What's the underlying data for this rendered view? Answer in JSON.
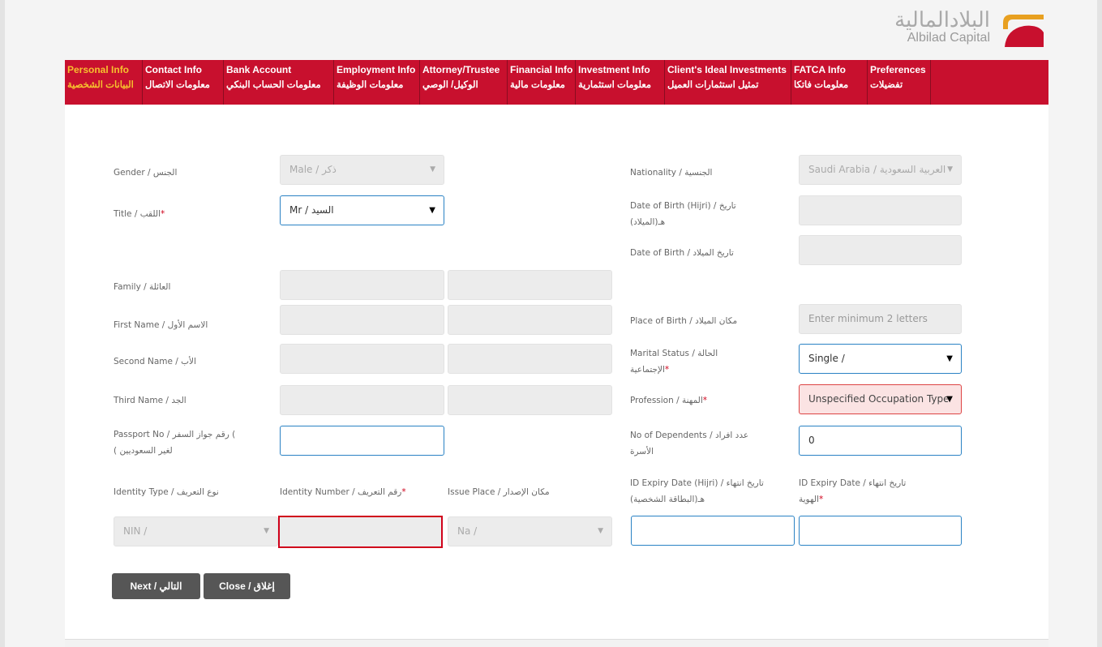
{
  "brand": {
    "name_ar": "البلادالمالية",
    "name_en": "Albilad Capital",
    "colors": {
      "primary": "#c8102e",
      "accent": "#e8a020",
      "active_tab": "#f6c02e"
    }
  },
  "nav": [
    {
      "en": "Personal Info",
      "ar": "البيانات الشخصية"
    },
    {
      "en": "Contact Info",
      "ar": "معلومات الاتصال"
    },
    {
      "en": "Bank Account",
      "ar": "معلومات الحساب البنكي"
    },
    {
      "en": "Employment Info",
      "ar": "معلومات الوظيفة"
    },
    {
      "en": "Attorney/Trustee",
      "ar": "الوكيل/ الوصي"
    },
    {
      "en": "Financial Info",
      "ar": "معلومات مالية"
    },
    {
      "en": "Investment Info",
      "ar": "معلومات استثمارية"
    },
    {
      "en": "Client's Ideal Investments",
      "ar": "تمثيل استثمارات العميل"
    },
    {
      "en": "FATCA Info",
      "ar": "معلومات فاتكا"
    },
    {
      "en": "Preferences",
      "ar": "تفضيلات"
    }
  ],
  "form": {
    "gender_label": "Gender / الجنس",
    "gender_value": "Male / ذكر",
    "title_label": "Title / اللقب",
    "title_value": "Mr / السيد",
    "family_label": "Family / العائلة",
    "first_name_label": "First Name / الاسم الأول",
    "second_name_label": "Second Name / الأب",
    "third_name_label": "Third Name / الجد",
    "passport_label_1": "Passport No / رقم جواز السفر (",
    "passport_label_2": "( لغير السعوديين",
    "identity_type_label": "Identity Type / نوع التعريف",
    "identity_type_value": "NIN /",
    "identity_number_label": "Identity Number / رقم التعريف",
    "issue_place_label": "Issue Place / مكان الإصدار",
    "issue_place_value": "Na /",
    "nationality_label": "Nationality / الجنسية",
    "nationality_value": "Saudi Arabia / العربية السعودية",
    "dob_hijri_label_1": "Date of Birth (Hijri) / تاريخ",
    "dob_hijri_label_2": "(الميلاد)هـ",
    "dob_label": "Date of Birth / تاريخ الميلاد",
    "place_of_birth_label": "Place of Birth / مكان الميلاد",
    "place_of_birth_placeholder": "Enter minimum 2 letters",
    "marital_label_1": "Marital Status / الحالة",
    "marital_label_2": "الإجتماعية",
    "marital_value": "Single /",
    "profession_label": "Profession / المهنة",
    "profession_value": "Unspecified Occupation Type",
    "dependents_label_1": "No of Dependents / عدد افراد",
    "dependents_label_2": "الأسرة",
    "dependents_value": "0",
    "id_expiry_hijri_label_1": "ID Expiry Date (Hijri) / تاريخ انتهاء",
    "id_expiry_hijri_label_2": "(البطاقة الشخصية)هـ",
    "id_expiry_label_1": "ID Expiry Date / تاريخ انتهاء",
    "id_expiry_label_2": "الهوية",
    "required_mark": "*"
  },
  "buttons": {
    "next": "Next / التالي",
    "close": "Close / إغلاق"
  }
}
